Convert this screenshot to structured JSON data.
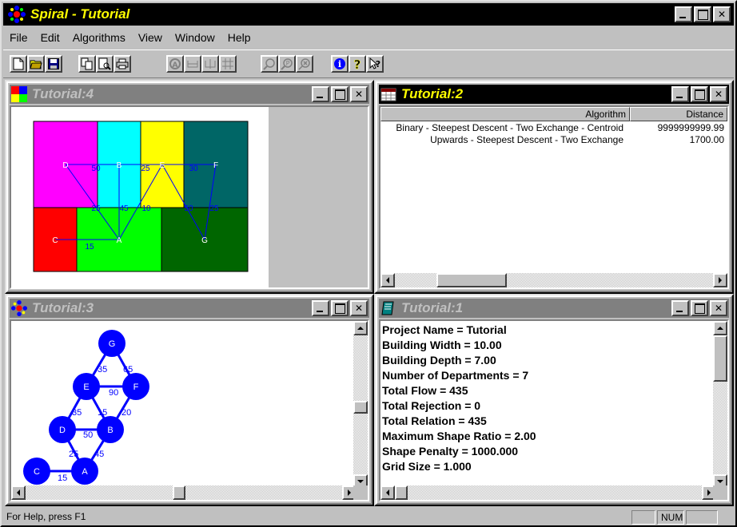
{
  "app": {
    "title": "Spiral - Tutorial"
  },
  "menu": {
    "items": [
      "File",
      "Edit",
      "Algorithms",
      "View",
      "Window",
      "Help"
    ]
  },
  "toolbar": {
    "icons": [
      "new-icon",
      "open-icon",
      "save-icon",
      "copy-icon",
      "print-preview-icon",
      "print-icon",
      "a-icon",
      "flat-icon",
      "crossing-icon",
      "grid-icon",
      "zoom-in-icon",
      "zoom-out-icon",
      "zoom-reset-icon",
      "info-icon",
      "help-icon",
      "context-help-icon"
    ]
  },
  "windows": {
    "layout": {
      "title": "Tutorial:4",
      "departments": [
        {
          "label": "D",
          "color": "#ff00ff"
        },
        {
          "label": "B",
          "color": "#00ffff"
        },
        {
          "label": "E",
          "color": "#ffff00"
        },
        {
          "label": "F",
          "color": "#006666"
        },
        {
          "label": "C",
          "color": "#ff0000"
        },
        {
          "label": "A",
          "color": "#00ff00"
        },
        {
          "label": "G",
          "color": "#006600"
        }
      ],
      "edge_labels": [
        "50",
        "25",
        "30",
        "25",
        "45",
        "10",
        "50",
        "25",
        "15"
      ]
    },
    "results": {
      "title": "Tutorial:2",
      "columns": [
        "Algorithm",
        "Distance"
      ],
      "rows": [
        {
          "algorithm": "Binary - Steepest Descent - Two Exchange - Centroid",
          "distance": "9999999999.99"
        },
        {
          "algorithm": "Upwards - Steepest Descent - Two Exchange",
          "distance": "1700.00"
        }
      ]
    },
    "graph": {
      "title": "Tutorial:3",
      "nodes": [
        "G",
        "E",
        "F",
        "D",
        "B",
        "C",
        "A"
      ],
      "edge_labels": [
        "35",
        "65",
        "90",
        "35",
        "15",
        "20",
        "50",
        "25",
        "45",
        "15"
      ]
    },
    "report": {
      "title": "Tutorial:1",
      "lines": [
        "Project Name = Tutorial",
        "Building Width = 10.00",
        "Building Depth = 7.00",
        "Number of Departments = 7",
        "Total Flow = 435",
        "Total Rejection = 0",
        "Total Relation = 435",
        "Maximum Shape Ratio = 2.00",
        "Shape Penalty = 1000.000",
        "Grid Size = 1.000"
      ]
    }
  },
  "status": {
    "text": "For Help, press F1",
    "num": "NUM"
  },
  "colors": {
    "title_text": "#ffff00",
    "graph_node": "#0000ff",
    "edge": "#0000ff"
  }
}
